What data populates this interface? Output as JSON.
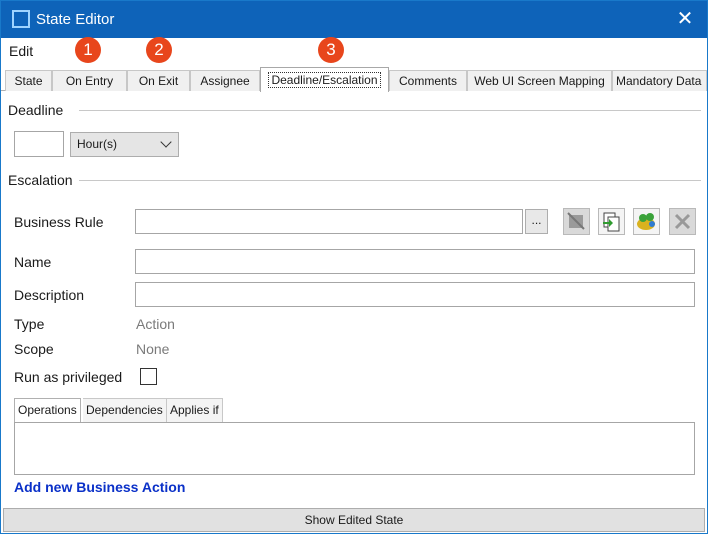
{
  "window": {
    "title": "State Editor",
    "close_glyph": "✕"
  },
  "menu": {
    "edit": "Edit"
  },
  "badges": [
    "1",
    "2",
    "3"
  ],
  "tabs": [
    "State",
    "On Entry",
    "On Exit",
    "Assignee",
    "Deadline/Escalation",
    "Comments",
    "Web UI Screen Mapping",
    "Mandatory Data"
  ],
  "active_tab": "Deadline/Escalation",
  "deadline": {
    "section_label": "Deadline",
    "amount_value": "",
    "unit_selected": "Hour(s)"
  },
  "escalation": {
    "section_label": "Escalation",
    "business_rule_label": "Business Rule",
    "business_rule_value": "",
    "browse_label": "...",
    "name_label": "Name",
    "name_value": "",
    "description_label": "Description",
    "description_value": "",
    "type_label": "Type",
    "type_value": "Action",
    "scope_label": "Scope",
    "scope_value": "None",
    "privileged_label": "Run as privileged",
    "privileged_checked": false,
    "toolbar_icons": [
      "edit-rule-icon",
      "copy-rule-icon",
      "new-rule-icon",
      "delete-rule-icon"
    ]
  },
  "subtabs": {
    "operations": "Operations",
    "dependencies": "Dependencies",
    "applies_if": "Applies if"
  },
  "add_action_label": "Add new Business Action",
  "bottom_button": "Show Edited State",
  "colors": {
    "titlebar": "#0e63b9",
    "badge": "#e8461c",
    "link": "#0a30c8"
  }
}
